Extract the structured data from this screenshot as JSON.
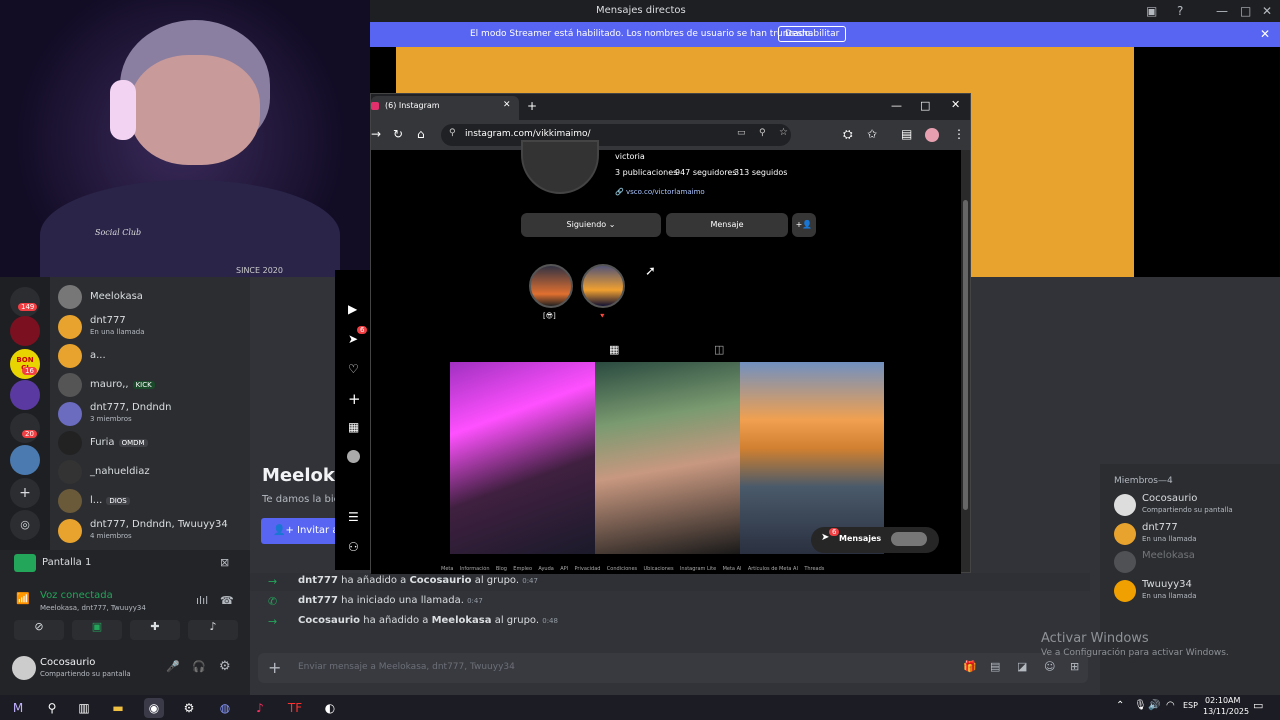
{
  "window": {
    "title": "Mensajes directos"
  },
  "banner": {
    "text": "El modo Streamer está habilitado. Los nombres de usuario se han truncado.",
    "button": "Deshabilitar"
  },
  "webcam": {
    "shirt_text": "Social Club",
    "overlay_text": "SINCE 2020"
  },
  "rail": {
    "badges": [
      "149",
      "16",
      "20"
    ],
    "server_label": "BON",
    "server_label2": "CI"
  },
  "dms": [
    {
      "name": "Meelokasa",
      "sub": "",
      "tag": ""
    },
    {
      "name": "dnt777",
      "sub": "En una llamada",
      "tag": ""
    },
    {
      "name": "a...",
      "sub": "",
      "tag": ""
    },
    {
      "name": "mauro,,",
      "sub": "",
      "tag": "KICK"
    },
    {
      "name": "dnt777, Dndndn",
      "sub": "3 miembros",
      "tag": ""
    },
    {
      "name": "Furia",
      "sub": "",
      "tag": "OMDM"
    },
    {
      "name": "_nahueldiaz",
      "sub": "",
      "tag": ""
    },
    {
      "name": "l...",
      "sub": "",
      "tag": "DIOS"
    },
    {
      "name": "dnt777, Dndndn, Twuuyy34",
      "sub": "4 miembros",
      "tag": ""
    }
  ],
  "voice": {
    "screen_label": "Pantalla 1",
    "status": "Voz conectada",
    "members": "Meelokasa, dnt777, Twuuyy34"
  },
  "user": {
    "name": "Cocosaurio",
    "status": "Compartiendo su pantalla"
  },
  "chat": {
    "heading": "Meeloka",
    "welcome": "Te damos la bien",
    "invite_button": "Invitar ami",
    "messages": [
      {
        "author": "dnt777",
        "text": "ha añadido a",
        "target": "Cocosaurio",
        "tail": "al grupo.",
        "time": "0:47"
      },
      {
        "author": "dnt777",
        "text": "ha iniciado una llamada.",
        "target": "",
        "tail": "",
        "time": "0:47"
      },
      {
        "author": "Cocosaurio",
        "text": "ha añadido a",
        "target": "Meelokasa",
        "tail": "al grupo.",
        "time": "0:48"
      }
    ],
    "input_placeholder": "Enviar mensaje a Meelokasa, dnt777, Twuuyy34"
  },
  "members": {
    "header": "Miembros—4",
    "list": [
      {
        "name": "Cocosaurio",
        "status": "Compartiendo su pantalla"
      },
      {
        "name": "dnt777",
        "status": "En una llamada"
      },
      {
        "name": "Meelokasa",
        "status": ""
      },
      {
        "name": "Twuuyy34",
        "status": "En una llamada"
      }
    ]
  },
  "windows_watermark": {
    "line1": "Activar Windows",
    "line2": "Ve a Configuración para activar Windows."
  },
  "chrome": {
    "tab_title": "(6) Instagram",
    "url": "instagram.com/vikkimaimo/",
    "profile": {
      "name": "victoria",
      "posts": "3 publicaciones",
      "followers": "947 seguidores",
      "following": "313 seguidos",
      "link": "vsco.co/victorlamaimo"
    },
    "buttons": {
      "following": "Siguiendo",
      "message": "Mensaje"
    },
    "highlights": [
      "[😎]",
      "🔻"
    ],
    "messages_bubble": "Mensajes",
    "messages_badge": "6",
    "notif_badge": "6",
    "footer": [
      "Meta",
      "Información",
      "Blog",
      "Empleo",
      "Ayuda",
      "API",
      "Privacidad",
      "Condiciones",
      "Ubicaciones",
      "Instagram Lite",
      "Meta AI",
      "Artículos de Meta AI",
      "Threads"
    ]
  },
  "taskbar": {
    "lang": "ESP",
    "time": "02:10AM",
    "date": "13/11/2025"
  },
  "colors": {
    "discord_bg": "#313338",
    "blurple": "#5865f2",
    "orange": "#e8a32e",
    "green": "#23a55a"
  }
}
